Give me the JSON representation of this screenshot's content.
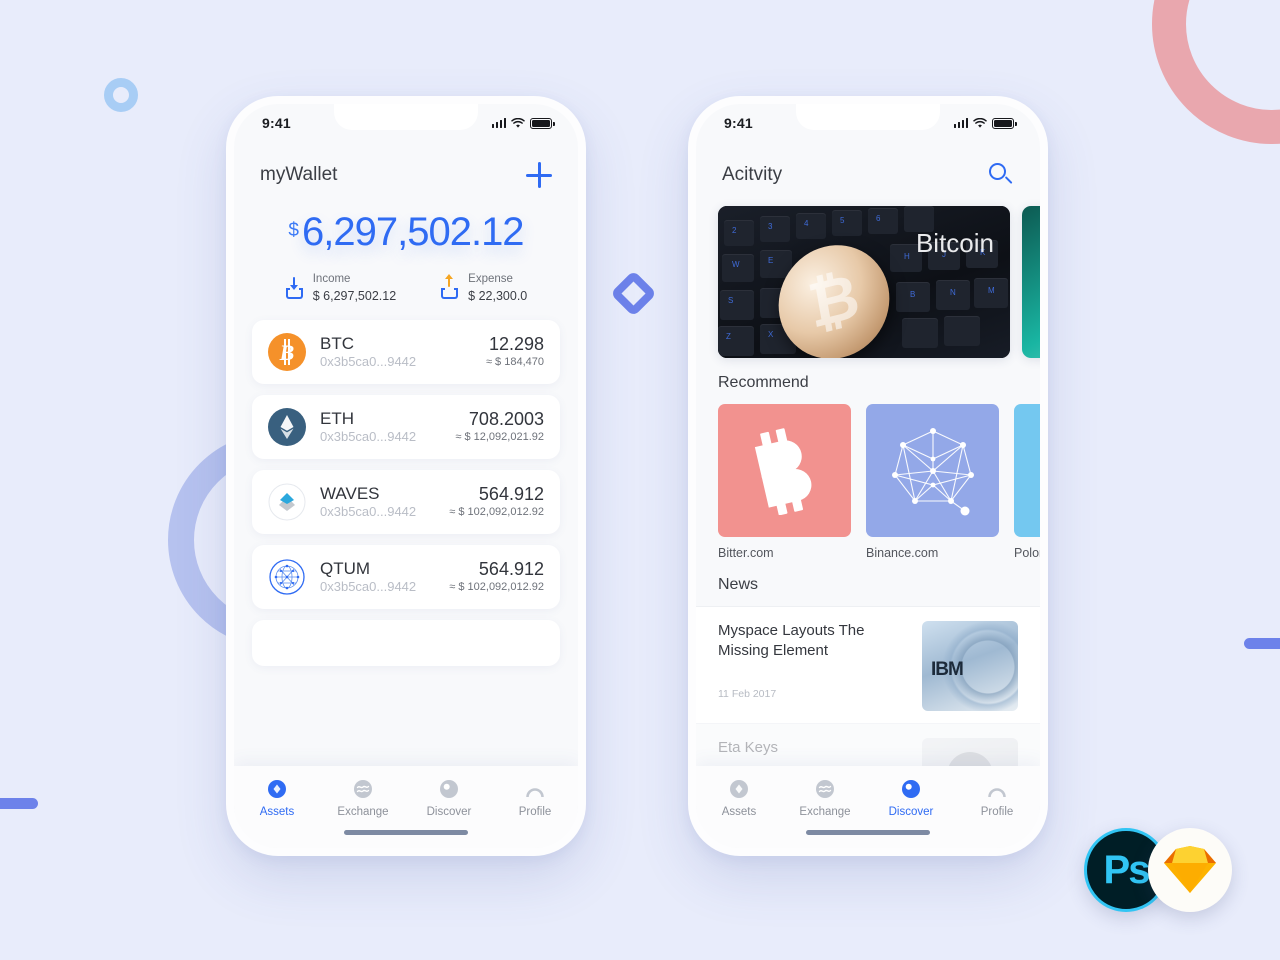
{
  "background": {
    "page_color": "#e8ecfb",
    "accent_blue": "#2f6bf3",
    "ring_pink": "#e9a7ae",
    "ring_periwinkle": "#b6c2ef",
    "ring_small_blue": "#a8cdf5",
    "bar_blue": "#6d82ea",
    "diamond_color": "#6d82ea"
  },
  "badges": {
    "photoshop_label": "Ps",
    "photoshop_icon": "photoshop-icon",
    "sketch_icon": "sketch-diamond-icon"
  },
  "phone_assets": {
    "status": {
      "time": "9:41",
      "signal_icon": "cellular-signal-icon",
      "wifi_icon": "wifi-icon",
      "battery_icon": "battery-full-icon"
    },
    "appbar": {
      "title": "myWallet",
      "add_icon": "plus-icon"
    },
    "balance": {
      "currency_symbol": "$",
      "amount": "6,297,502.12",
      "flows": [
        {
          "label": "Income",
          "value": "$ 6,297,502.12",
          "icon": "arrow-down-tray-icon",
          "color": "#2f6bf3"
        },
        {
          "label": "Expense",
          "value": "$ 22,300.0",
          "icon": "arrow-up-tray-icon",
          "color": "#f5a623"
        }
      ]
    },
    "assets": [
      {
        "symbol": "BTC",
        "address": "0x3b5ca0...9442",
        "quantity": "12.298",
        "fiat": "≈ $ 184,470",
        "icon": "bitcoin-coin-icon",
        "color": "#f5912a"
      },
      {
        "symbol": "ETH",
        "address": "0x3b5ca0...9442",
        "quantity": "708.2003",
        "fiat": "≈ $ 12,092,021.92",
        "icon": "ethereum-coin-icon",
        "color": "#39607f"
      },
      {
        "symbol": "WAVES",
        "address": "0x3b5ca0...9442",
        "quantity": "564.912",
        "fiat": "≈ $ 102,092,012.92",
        "icon": "waves-coin-icon",
        "color": "#2ba8dd"
      },
      {
        "symbol": "QTUM",
        "address": "0x3b5ca0...9442",
        "quantity": "564.912",
        "fiat": "≈ $ 102,092,012.92",
        "icon": "qtum-coin-icon",
        "color": "#2f6bf3"
      }
    ],
    "tabs": [
      {
        "label": "Assets",
        "icon": "assets-diamond-icon",
        "active": true
      },
      {
        "label": "Exchange",
        "icon": "exchange-waves-icon",
        "active": false
      },
      {
        "label": "Discover",
        "icon": "discover-circle-icon",
        "active": false
      },
      {
        "label": "Profile",
        "icon": "profile-person-icon",
        "active": false
      }
    ]
  },
  "phone_discover": {
    "status": {
      "time": "9:41",
      "signal_icon": "cellular-signal-icon",
      "wifi_icon": "wifi-icon",
      "battery_icon": "battery-full-icon"
    },
    "appbar": {
      "title": "Acitvity",
      "search_icon": "search-icon"
    },
    "banner": {
      "caption": "Bitcoin",
      "image": "bitcoin-coin-on-keyboard-photo"
    },
    "recommend": {
      "heading": "Recommend",
      "items": [
        {
          "name": "Bitter.com",
          "icon": "bitcoin-b-icon",
          "color": "#f2928f"
        },
        {
          "name": "Binance.com",
          "icon": "network-graph-icon",
          "color": "#93a8e8"
        },
        {
          "name": "Polonie",
          "icon": "star-icon",
          "color": "#74c8f0"
        }
      ]
    },
    "news": {
      "heading": "News",
      "items": [
        {
          "title": "Myspace Layouts The Missing Element",
          "date": "11 Feb 2017",
          "thumb": "ibm-server-photo",
          "faded": false
        },
        {
          "title": "Eta Keys",
          "date": "",
          "thumb": "avatar-photo",
          "faded": true
        }
      ]
    },
    "tabs": [
      {
        "label": "Assets",
        "icon": "assets-diamond-icon",
        "active": false
      },
      {
        "label": "Exchange",
        "icon": "exchange-waves-icon",
        "active": false
      },
      {
        "label": "Discover",
        "icon": "discover-circle-icon",
        "active": true
      },
      {
        "label": "Profile",
        "icon": "profile-person-icon",
        "active": false
      }
    ]
  }
}
